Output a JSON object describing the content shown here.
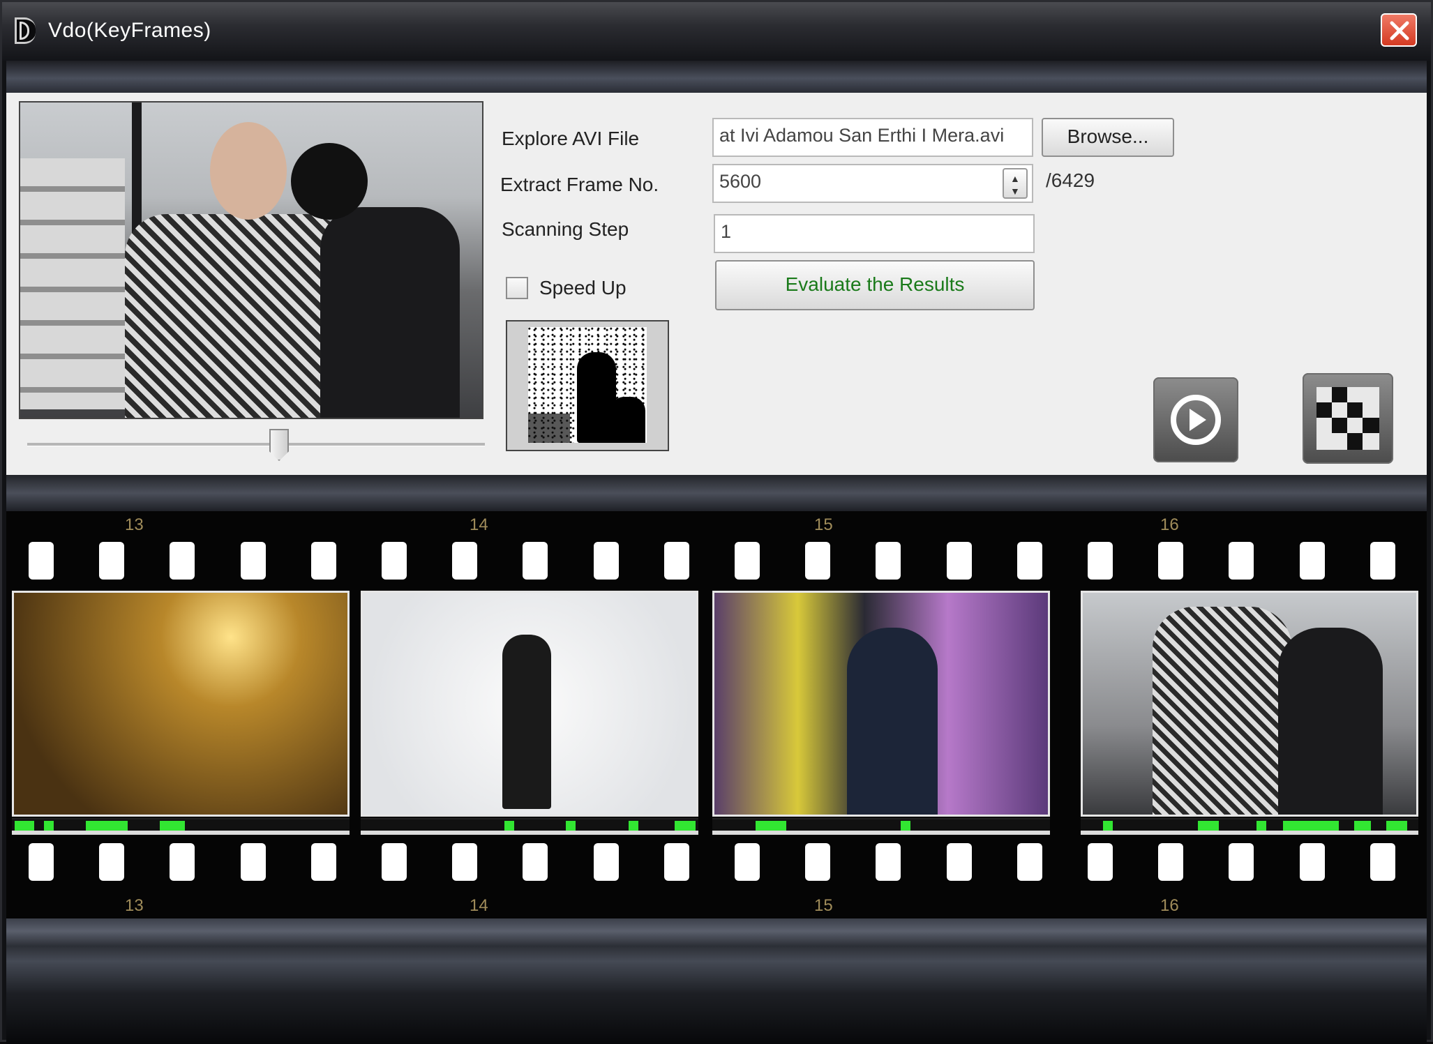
{
  "window": {
    "title": "Vdo(KeyFrames)"
  },
  "form": {
    "explore_label": "Explore AVI File",
    "file_value": "at Ivi Adamou San Erthi I Mera.avi",
    "browse_label": "Browse...",
    "extract_label": "Extract Frame No.",
    "frame_value": "5600",
    "total_frames": "/6429",
    "scan_label": "Scanning Step",
    "scan_value": "1",
    "speedup_label": "Speed Up",
    "speedup_checked": false,
    "evaluate_label": "Evaluate the Results",
    "evaluate_color": "#1a7a1a"
  },
  "preview": {
    "slider_fraction": 0.55
  },
  "filmstrip": {
    "frames": [
      {
        "number": "13"
      },
      {
        "number": "14"
      },
      {
        "number": "15"
      },
      {
        "number": "16"
      }
    ]
  },
  "colors": {
    "accent_green": "#32e632",
    "close_red": "#d43a22"
  }
}
